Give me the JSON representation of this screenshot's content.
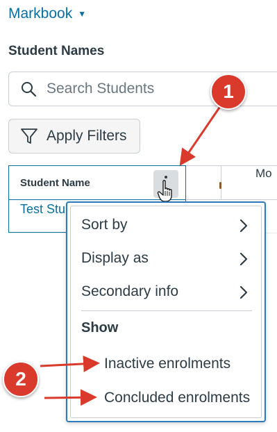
{
  "header": {
    "markbook_label": "Markbook"
  },
  "heading": "Student Names",
  "search": {
    "placeholder": "Search Students",
    "value": ""
  },
  "filters": {
    "label": "Apply Filters"
  },
  "grid": {
    "name_column_header": "Student Name",
    "next_column_header": "Mo",
    "rows": [
      {
        "name": "Test Stu"
      }
    ]
  },
  "menu": {
    "items": [
      {
        "label": "Sort by"
      },
      {
        "label": "Display as"
      },
      {
        "label": "Secondary info"
      }
    ],
    "show_heading": "Show",
    "show_options": [
      {
        "label": "Inactive enrolments"
      },
      {
        "label": "Concluded enrolments"
      }
    ]
  },
  "annotations": {
    "badge_1": "1",
    "badge_2": "2"
  },
  "colors": {
    "link": "#0770a3",
    "text": "#2d3b45",
    "border": "#c7cdd1",
    "annotation_red": "#d93a2b",
    "menu_border": "#2b7abc"
  }
}
